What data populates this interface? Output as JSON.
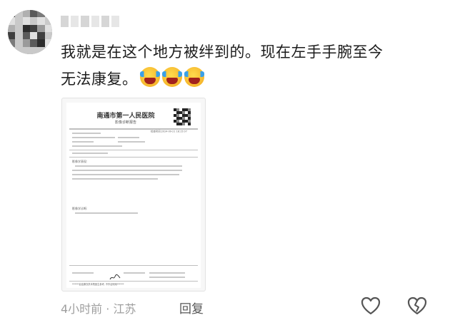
{
  "comment": {
    "line1": "我就是在这个地方被绊到的。现在左手手腕至今",
    "line2": "无法康复。",
    "emojis": [
      "loudly-crying-face-icon",
      "loudly-crying-face-icon",
      "loudly-crying-face-icon"
    ]
  },
  "report": {
    "hospital": "南通市第一人民医院",
    "title": "影像诊断报告",
    "section_findings": "影像学表现:",
    "section_diagnosis": "影像学诊断:",
    "report_time": "检查时间:2024-09-21 18:15:07",
    "footer_note": "******此结果仅供本院医生参考, 不作证明用******"
  },
  "meta": {
    "time_location": "4小时前 · 江苏",
    "reply_label": "回复"
  },
  "colors": {
    "accent_text": "#1c1c1c",
    "meta_text": "#9e9e9e"
  }
}
